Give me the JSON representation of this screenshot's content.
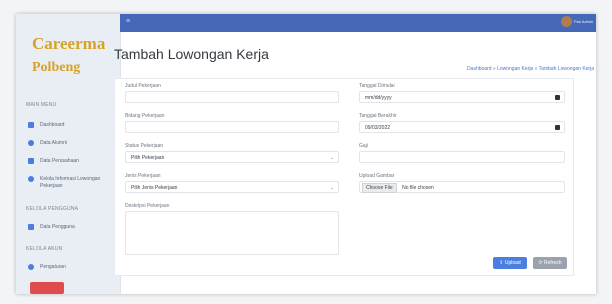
{
  "brand": {
    "line1": "Careerma",
    "line2": "Polbeng"
  },
  "sidebar": {
    "section_main": "MAIN MENU",
    "items": [
      {
        "label": "Dashboard",
        "icon": "dashboard-icon"
      },
      {
        "label": "Data Alumni",
        "icon": "alumni-icon"
      },
      {
        "label": "Data Perusahaan",
        "icon": "company-icon"
      },
      {
        "label": "Kelola Informasi Lowongan Pekerjaan",
        "icon": "briefcase-icon"
      }
    ],
    "section_users": "KELOLA PENGGUNA",
    "user_item": {
      "label": "Data Pengguna",
      "icon": "users-icon"
    },
    "section_account": "KELOLA AKUN",
    "account_item": {
      "label": "Pengaturan",
      "icon": "gear-icon"
    }
  },
  "topbar": {
    "user": "Pak Admin"
  },
  "page": {
    "title": "Tambah Lowongan Kerja",
    "breadcrumb": "Dashboard » Lowongan Kerja » Tambah Lowongan Kerja"
  },
  "form": {
    "judul_label": "Judul Pekerjaan",
    "bidang_label": "Bidang Pekerjaan",
    "status_label": "Status Pekerjaan",
    "status_value": "Pilih Pekerjaan",
    "jenis_label": "Jenis Pekerjaan",
    "jenis_value": "Pilih Jenis Pekerjaan",
    "deskripsi_label": "Deskripsi Pekerjaan",
    "mulai_label": "Tanggal Dimulai",
    "mulai_value": "mm/dd/yyyy",
    "berakhir_label": "Tanggal Berakhir",
    "berakhir_value": "09/03/2022",
    "gaji_label": "Gaji",
    "gambar_label": "Upload Gambar",
    "file_button": "Choose File",
    "file_status": "No file chosen",
    "upload_button": "Upload",
    "refresh_button": "Refresh"
  },
  "colors": {
    "brand": "#d6a328",
    "topbar": "#4668b9",
    "primary": "#4a7fe0",
    "secondary": "#9aa3ad",
    "logout": "#e04b4b"
  }
}
